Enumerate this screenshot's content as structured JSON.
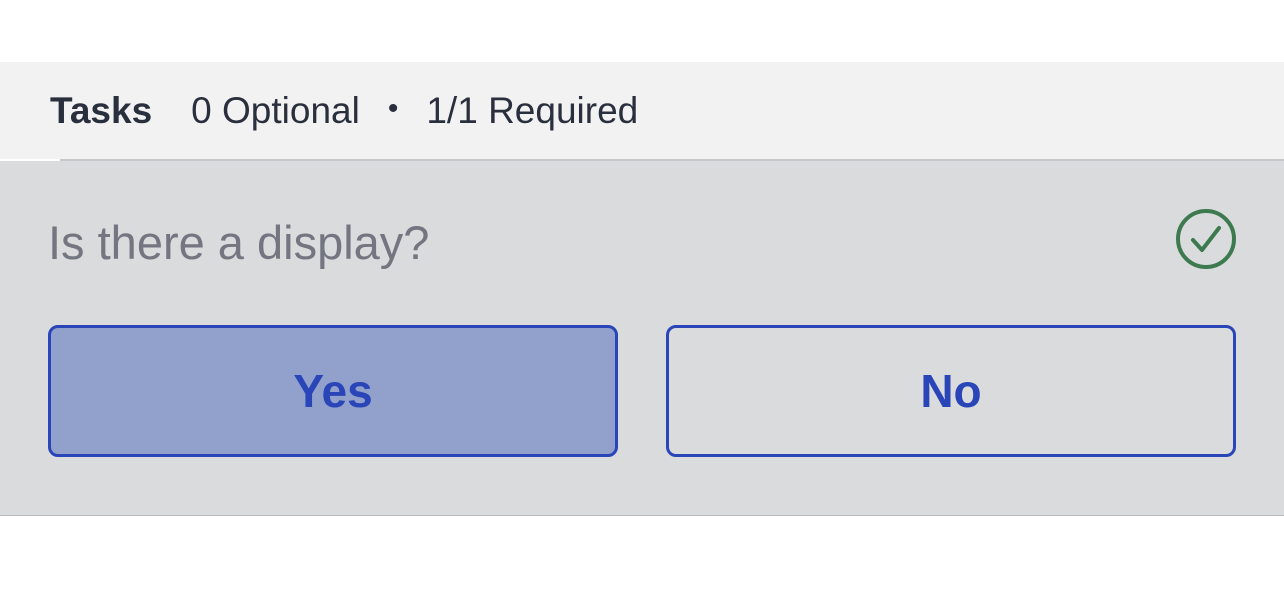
{
  "tasks": {
    "title": "Tasks",
    "optional": "0 Optional",
    "separator": "•",
    "required": "1/1 Required"
  },
  "task": {
    "question": "Is there a display?",
    "status_icon": "check-circle-icon",
    "answers": {
      "yes_label": "Yes",
      "no_label": "No",
      "selected": "Yes"
    }
  },
  "colors": {
    "accent": "#2a45b8",
    "selected_fill": "#91a1cb",
    "check": "#3d7a4f",
    "card_bg": "#dadbdd",
    "header_bg": "#f2f2f2"
  }
}
